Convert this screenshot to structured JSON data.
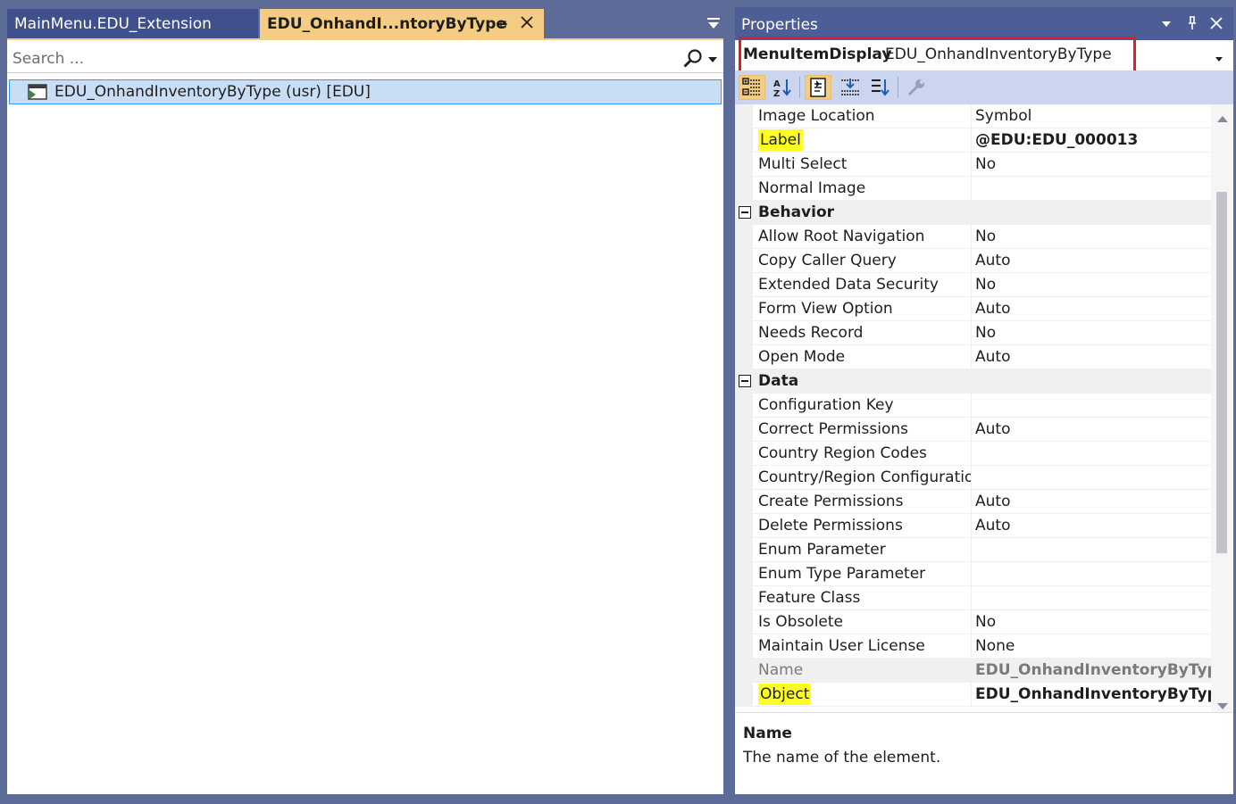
{
  "document_tabs": {
    "inactive_label": "MainMenu.EDU_Extension",
    "active_label": "EDU_OnhandI...ntoryByType"
  },
  "search": {
    "placeholder": "Search ..."
  },
  "tree": {
    "item_label": "EDU_OnhandInventoryByType (usr) [EDU]"
  },
  "properties": {
    "title": "Properties",
    "object_type": "MenuItemDisplay",
    "object_name": "EDU_OnhandInventoryByType",
    "rows_top": [
      {
        "name": "Image Location",
        "value": "Symbol"
      },
      {
        "name": "Label",
        "value": "@EDU:EDU_000013"
      },
      {
        "name": "Multi Select",
        "value": "No"
      },
      {
        "name": "Normal Image",
        "value": ""
      }
    ],
    "categories": [
      {
        "label": "Behavior",
        "rows": [
          {
            "name": "Allow Root Navigation",
            "value": "No"
          },
          {
            "name": "Copy Caller Query",
            "value": "Auto"
          },
          {
            "name": "Extended Data Security",
            "value": "No"
          },
          {
            "name": "Form View Option",
            "value": "Auto"
          },
          {
            "name": "Needs Record",
            "value": "No"
          },
          {
            "name": "Open Mode",
            "value": "Auto"
          }
        ]
      },
      {
        "label": "Data",
        "rows": [
          {
            "name": "Configuration Key",
            "value": ""
          },
          {
            "name": "Correct Permissions",
            "value": "Auto"
          },
          {
            "name": "Country Region Codes",
            "value": ""
          },
          {
            "name": "Country/Region Configuration",
            "value": ""
          },
          {
            "name": "Create Permissions",
            "value": "Auto"
          },
          {
            "name": "Delete Permissions",
            "value": "Auto"
          },
          {
            "name": "Enum Parameter",
            "value": ""
          },
          {
            "name": "Enum Type Parameter",
            "value": ""
          },
          {
            "name": "Feature Class",
            "value": ""
          },
          {
            "name": "Is Obsolete",
            "value": "No"
          },
          {
            "name": "Maintain User License",
            "value": "None"
          },
          {
            "name": "Name",
            "value": "EDU_OnhandInventoryByType"
          },
          {
            "name": "Object",
            "value": "EDU_OnhandInventoryByType"
          }
        ]
      }
    ],
    "description": {
      "title": "Name",
      "text": "The name of the element."
    }
  },
  "colors": {
    "background": "#5d6b99",
    "active_tab": "#f5cc84",
    "highlight": "#ffff24",
    "annotation_box": "#e21d24",
    "selection": "#c9def5"
  },
  "icons": [
    "pin-icon",
    "close-icon",
    "dropdown-icon",
    "search-icon",
    "menu-item-icon",
    "categorized-icon",
    "alphabetical-icon",
    "properties-icon",
    "events-icon",
    "property-pages-icon",
    "wrench-icon"
  ]
}
